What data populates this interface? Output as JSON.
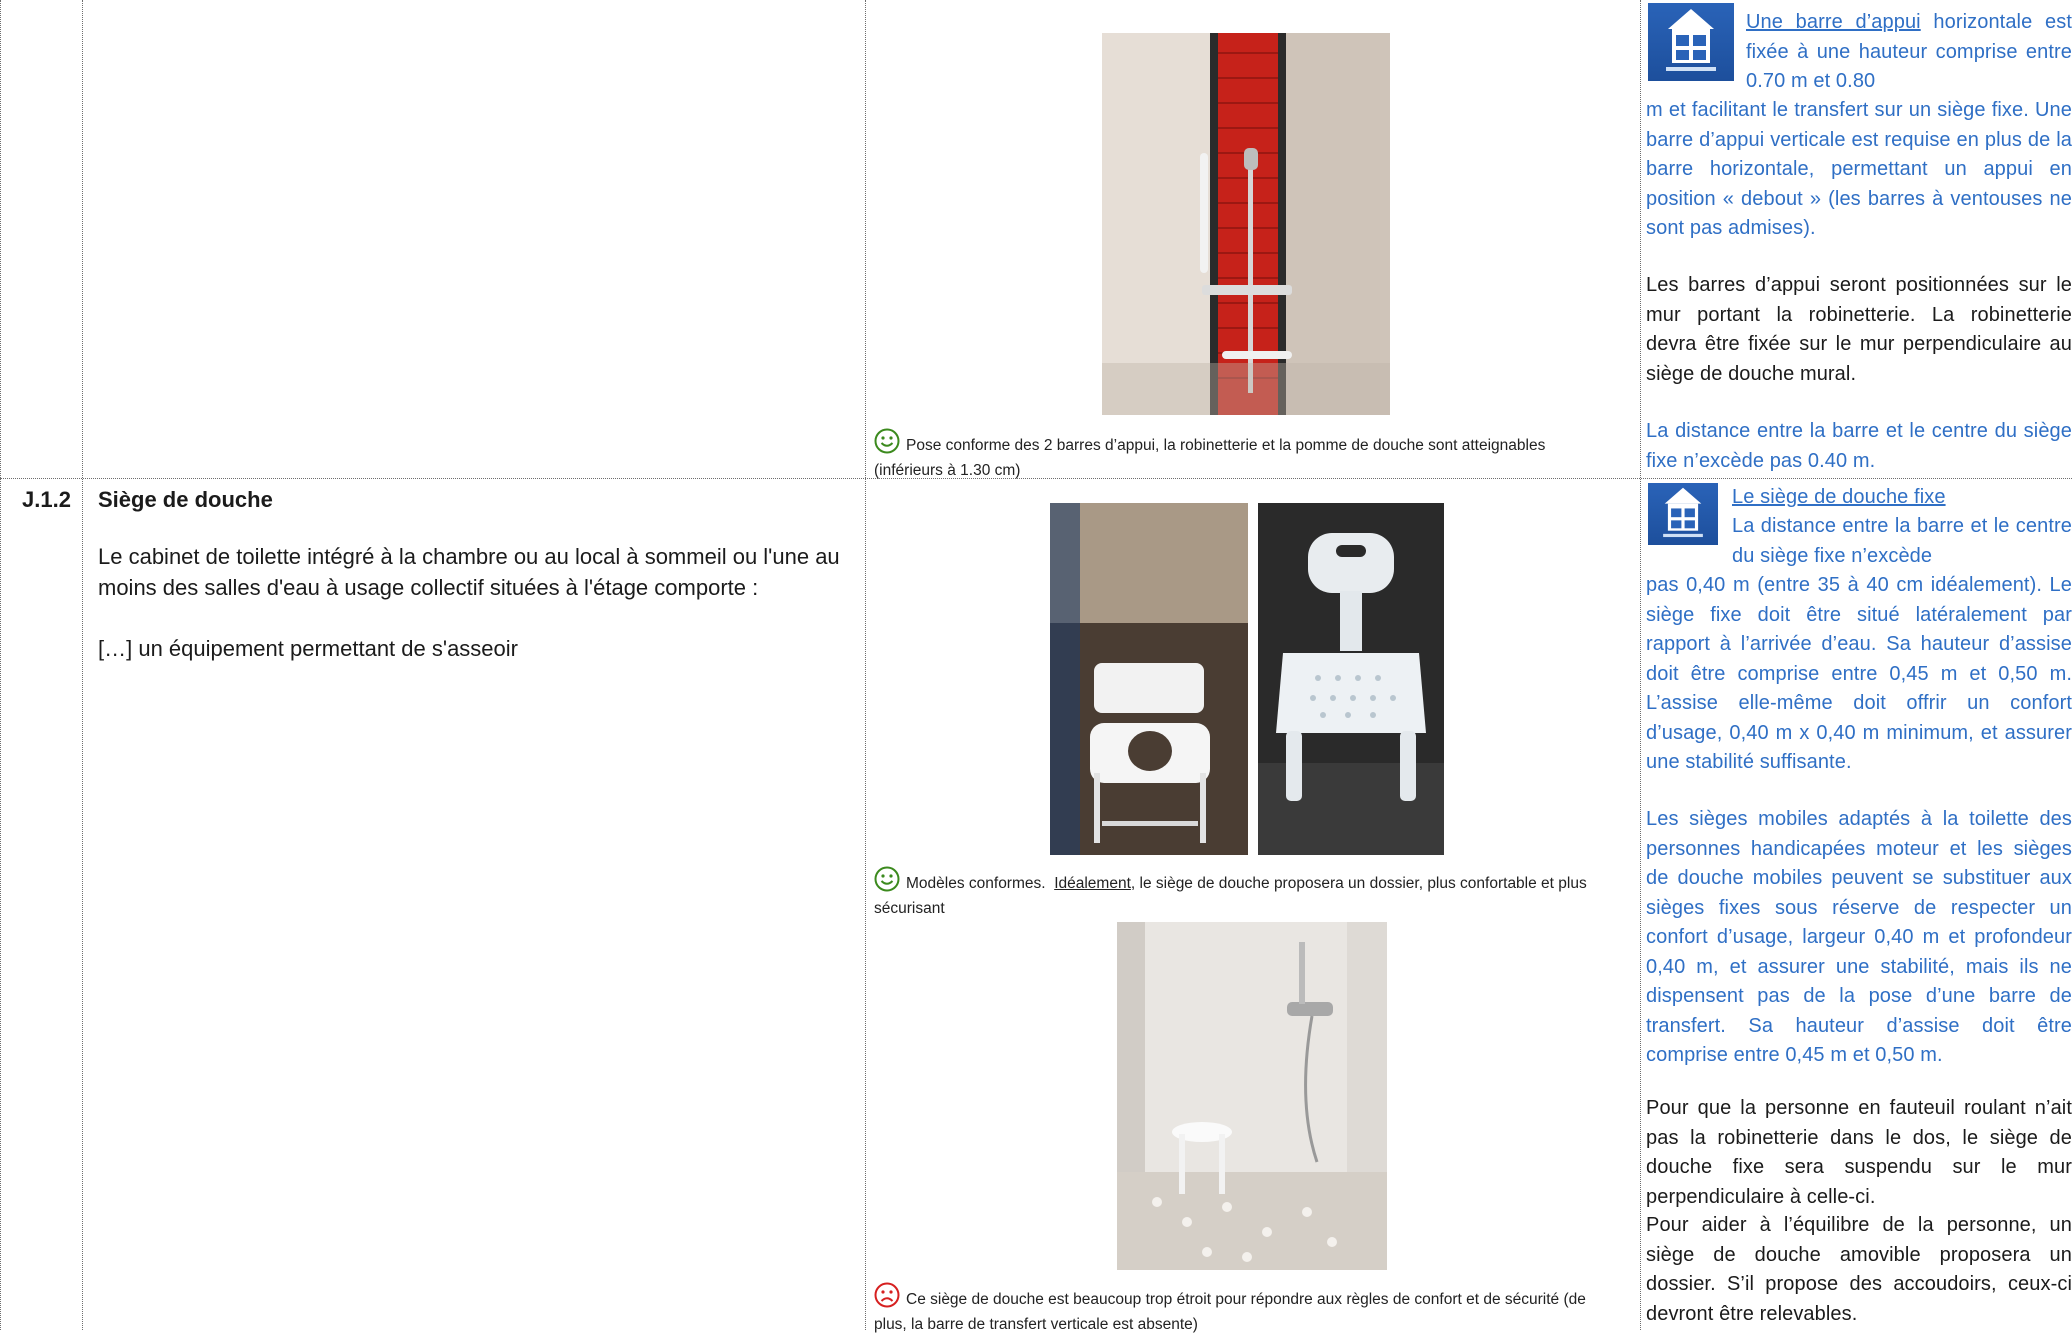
{
  "section": {
    "code": "J.1.2",
    "title": "Siège de douche",
    "paragraph_1": "Le cabinet de toilette intégré à la chambre ou au local à sommeil ou l'une au moins des salles d'eau à usage collectif situées à l'étage comporte :",
    "paragraph_2": "[…] un équipement permettant de s'asseoir"
  },
  "captions": {
    "photo_1": "Pose conforme des 2 barres d’appui, la robinetterie et la pomme de douche sont atteignables (inférieurs à 1.30 cm)",
    "photo_2_prefix": "Modèles conformes.",
    "photo_2_underlined": "Idéalement",
    "photo_2_suffix": ", le siège de douche proposera un dossier, plus confortable et plus sécurisant",
    "photo_3": "Ce siège de douche est beaucoup trop étroit pour répondre aux règles de confort et de sécurité (de plus, la barre de transfert verticale est absente)"
  },
  "right_column": {
    "block_1_link": "Une barre d’appui",
    "block_1_text": " horizontale est fixée à une hauteur comprise entre 0.70 m et 0.80 m et facilitant le transfert sur un siège fixe. Une barre d’appui verticale est requise en plus de la barre horizontale, permettant un appui en position « debout » (les barres à ventouses ne sont pas admises).",
    "block_2": "Les barres d’appui seront positionnées sur le mur portant la robinetterie. La robinetterie devra être fixée sur le mur perpendiculaire au siège de douche mural.",
    "block_3": "La distance entre la barre et le centre du siège fixe n’excède pas 0.40 m.",
    "block_4_link": "Le siège de douche fixe",
    "block_4_text": "La distance entre la barre et le centre du siège fixe n’excède pas 0,40 m (entre 35 à 40 cm idéalement). Le siège fixe doit être situé latéralement par rapport à l’arrivée d’eau. Sa hauteur d’assise doit être comprise entre 0,45 m et 0,50 m. L’assise elle-même doit offrir un confort d’usage, 0,40 m x 0,40 m minimum, et assurer une stabilité suffisante.",
    "block_5": "Les sièges mobiles adaptés à la toilette des personnes handicapées moteur et les sièges de douche mobiles peuvent se substituer aux sièges fixes sous réserve de respecter un confort d’usage, largeur 0,40 m et profondeur 0,40 m, et assurer une stabilité, mais ils ne dispensent pas de la pose d’une barre de transfert. Sa hauteur d’assise doit être comprise entre 0,45 m et 0,50 m.",
    "block_6": "Pour que la personne en fauteuil roulant n’ait pas la robinetterie dans le dos, le siège de douche fixe sera suspendu sur le mur perpendiculaire à celle-ci.",
    "block_7": "Pour aider à l’équilibre de la personne, un siège de douche amovible proposera un dossier.  S’il propose des accoudoirs, ceux-ci devront être relevables."
  },
  "colors": {
    "blue_text": "#2f6fc5",
    "body_text": "#1b1b1b",
    "smiley_green": "#3c8a1e",
    "frown_red": "#d62020",
    "logo_blue": "#1d4f9c"
  },
  "icons": {
    "positive": "smiley-face-icon",
    "negative": "frowning-face-icon",
    "logo": "accessibility-label-logo"
  }
}
